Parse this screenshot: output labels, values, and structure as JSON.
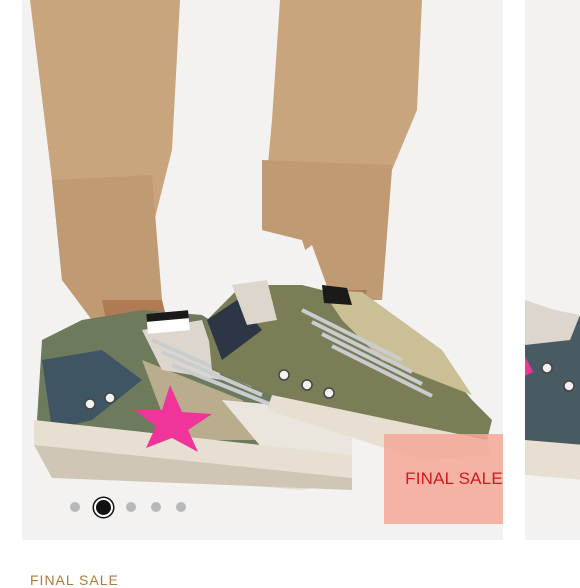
{
  "listing": {
    "badge_text": "FINAL SALE",
    "status_label": "FINAL SALE"
  },
  "carousel": {
    "total_slides": 5,
    "active_index": 1,
    "current_image": "sneakers-on-model",
    "next_image": "sneaker-side"
  },
  "colors": {
    "badge_bg": "#f5a898",
    "badge_text": "#d21a1a",
    "dot_inactive": "#b8b8b8",
    "dot_active": "#111111",
    "status_label": "#b07a3a"
  }
}
